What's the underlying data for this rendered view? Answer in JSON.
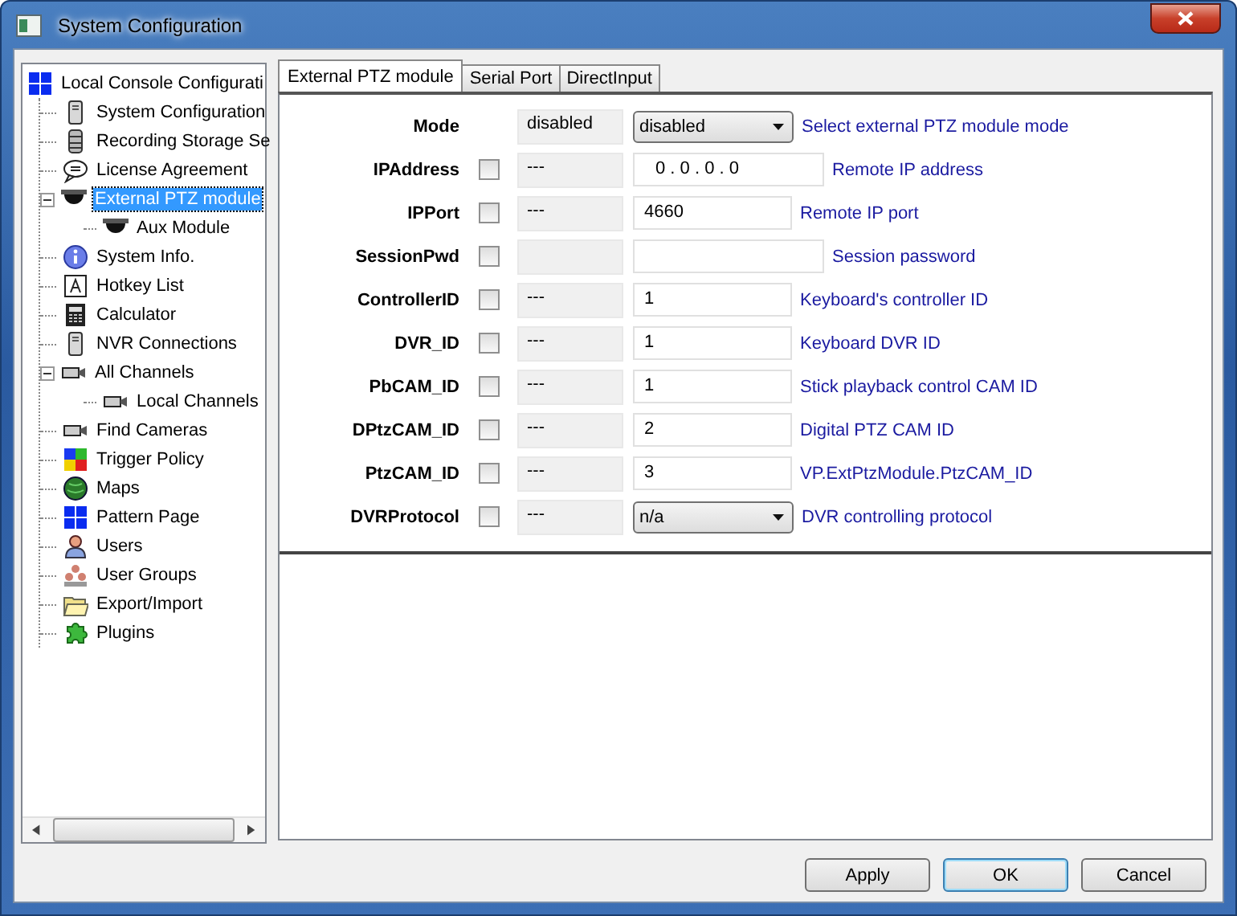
{
  "window": {
    "title": "System Configuration"
  },
  "tree": [
    {
      "label": "Local Console Configurati",
      "kind": "grid",
      "selected": false,
      "children": [
        {
          "label": "System Configuration",
          "kind": "server",
          "selected": false
        },
        {
          "label": "Recording Storage Se",
          "kind": "database",
          "selected": false
        },
        {
          "label": "License Agreement",
          "kind": "speech",
          "selected": false
        },
        {
          "label": "External PTZ module",
          "kind": "dome",
          "selected": true,
          "expanded": true,
          "children": [
            {
              "label": "Aux Module",
              "kind": "dome",
              "selected": false
            }
          ]
        },
        {
          "label": "System Info.",
          "kind": "info",
          "selected": false
        },
        {
          "label": "Hotkey List",
          "kind": "hotkey",
          "selected": false
        },
        {
          "label": "Calculator",
          "kind": "calculator",
          "selected": false
        },
        {
          "label": "NVR Connections",
          "kind": "server",
          "selected": false
        },
        {
          "label": "All Channels",
          "kind": "camera",
          "selected": false,
          "expanded": true,
          "children": [
            {
              "label": "Local Channels",
              "kind": "camera",
              "selected": false
            }
          ]
        },
        {
          "label": "Find Cameras",
          "kind": "camera",
          "selected": false
        },
        {
          "label": "Trigger Policy",
          "kind": "trigger",
          "selected": false
        },
        {
          "label": "Maps",
          "kind": "globe",
          "selected": false
        },
        {
          "label": "Pattern Page",
          "kind": "grid",
          "selected": false
        },
        {
          "label": "Users",
          "kind": "user",
          "selected": false
        },
        {
          "label": "User Groups",
          "kind": "users",
          "selected": false
        },
        {
          "label": "Export/Import",
          "kind": "folder",
          "selected": false
        },
        {
          "label": "Plugins",
          "kind": "puzzle",
          "selected": false
        }
      ]
    }
  ],
  "tabs": [
    {
      "label": "External PTZ module",
      "selected": true
    },
    {
      "label": "Serial Port",
      "selected": false
    },
    {
      "label": "DirectInput",
      "selected": false
    }
  ],
  "fields": [
    {
      "label": "Mode",
      "current": "disabled",
      "kind": "dropdown",
      "value": "disabled",
      "description": "Select external PTZ module mode"
    },
    {
      "label": "IPAddress",
      "checked": false,
      "current": "---",
      "kind": "ip",
      "value": "0 . 0 . 0 . 0",
      "description": "Remote IP address"
    },
    {
      "label": "IPPort",
      "checked": false,
      "current": "---",
      "kind": "text",
      "value": "4660",
      "description": "Remote IP port"
    },
    {
      "label": "SessionPwd",
      "checked": false,
      "kind": "password",
      "description": "Session password"
    },
    {
      "label": "ControllerID",
      "checked": false,
      "current": "---",
      "kind": "text",
      "value": "1",
      "description": "Keyboard's controller ID"
    },
    {
      "label": "DVR_ID",
      "checked": false,
      "current": "---",
      "kind": "text",
      "value": "1",
      "description": "Keyboard DVR ID"
    },
    {
      "label": "PbCAM_ID",
      "checked": false,
      "current": "---",
      "kind": "text",
      "value": "1",
      "description": "Stick playback control CAM ID"
    },
    {
      "label": "DPtzCAM_ID",
      "checked": false,
      "current": "---",
      "kind": "text",
      "value": "2",
      "description": "Digital PTZ CAM ID"
    },
    {
      "label": "PtzCAM_ID",
      "checked": false,
      "current": "---",
      "kind": "text",
      "value": "3",
      "description": "VP.ExtPtzModule.PtzCAM_ID"
    },
    {
      "label": "DVRProtocol",
      "checked": false,
      "current": "---",
      "kind": "dropdown",
      "value": "n/a",
      "description": "DVR controlling protocol"
    }
  ],
  "buttons": [
    {
      "label": "Apply",
      "default": false
    },
    {
      "label": "OK",
      "default": true
    },
    {
      "label": "Cancel",
      "default": false
    }
  ]
}
